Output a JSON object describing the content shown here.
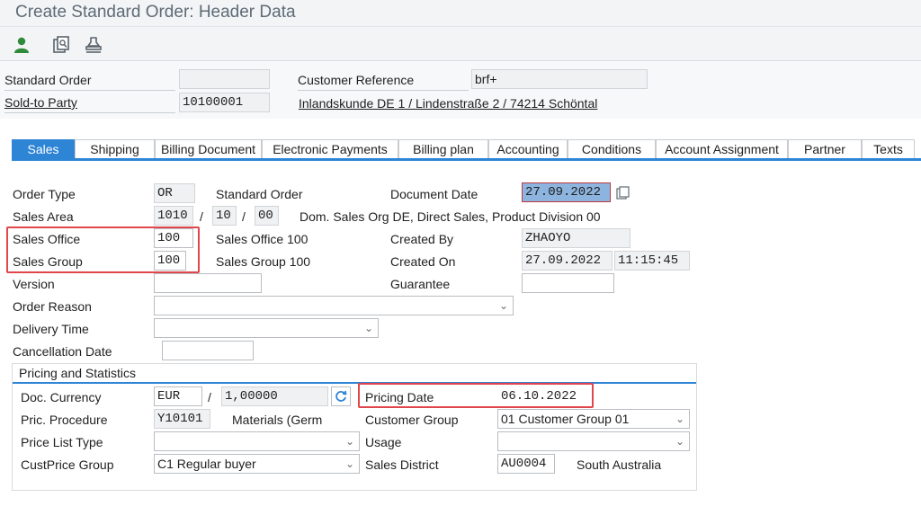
{
  "window": {
    "title": "Create Standard Order: Header Data"
  },
  "toolbar": {
    "icons": [
      "person-icon",
      "display-doc-icon",
      "stamp-icon"
    ]
  },
  "header": {
    "standard_order": {
      "label": "Standard Order",
      "value": ""
    },
    "sold_to": {
      "label": "Sold-to Party",
      "value": "10100001",
      "address": "Inlandskunde DE 1 / Lindenstraße 2 / 74214 Schöntal"
    },
    "customer_reference": {
      "label": "Customer Reference",
      "value": "brf+"
    }
  },
  "tabs": [
    {
      "label": "Sales",
      "active": true
    },
    {
      "label": "Shipping"
    },
    {
      "label": "Billing Document"
    },
    {
      "label": "Electronic Payments"
    },
    {
      "label": "Billing plan"
    },
    {
      "label": "Accounting"
    },
    {
      "label": "Conditions"
    },
    {
      "label": "Account Assignment"
    },
    {
      "label": "Partner"
    },
    {
      "label": "Texts"
    }
  ],
  "sales": {
    "order_type": {
      "label": "Order Type",
      "value": "OR",
      "desc": "Standard Order"
    },
    "sales_area": {
      "label": "Sales Area",
      "sales_org": "1010",
      "sep1": "/",
      "distr_channel": "10",
      "sep2": "/",
      "division": "00",
      "desc": "Dom. Sales Org DE, Direct Sales, Product Division 00"
    },
    "sales_office": {
      "label": "Sales Office",
      "value": "100",
      "desc": "Sales Office 100"
    },
    "sales_group": {
      "label": "Sales Group",
      "value": "100",
      "desc": "Sales Group 100"
    },
    "version": {
      "label": "Version",
      "value": ""
    },
    "order_reason": {
      "label": "Order Reason",
      "value": ""
    },
    "delivery_time": {
      "label": "Delivery Time",
      "value": ""
    },
    "cancellation_date": {
      "label": "Cancellation Date",
      "value": ""
    },
    "document_date": {
      "label": "Document Date",
      "value": "27.09.2022"
    },
    "created_by": {
      "label": "Created By",
      "value": "ZHAOYO"
    },
    "created_on": {
      "label": "Created On",
      "date": "27.09.2022",
      "time": "11:15:45"
    },
    "guarantee": {
      "label": "Guarantee",
      "value": ""
    }
  },
  "pricing": {
    "title": "Pricing and Statistics",
    "doc_currency": {
      "label": "Doc. Currency",
      "value": "EUR",
      "sep": "/",
      "rate": "1,00000"
    },
    "pric_procedure": {
      "label": "Pric. Procedure",
      "value": "Y10101",
      "desc": "Materials (Germ"
    },
    "price_list_type": {
      "label": "Price List Type",
      "value": ""
    },
    "cust_price_group": {
      "label": "CustPrice Group",
      "value": "C1 Regular buyer"
    },
    "pricing_date": {
      "label": "Pricing Date",
      "value": "06.10.2022"
    },
    "customer_group": {
      "label": "Customer Group",
      "value": "01 Customer Group 01"
    },
    "usage": {
      "label": "Usage",
      "value": ""
    },
    "sales_district": {
      "label": "Sales District",
      "value": "AU0004",
      "desc": "South Australia"
    }
  },
  "colors": {
    "tab_active": "#2e84d5",
    "highlight_box": "#e0474c"
  }
}
